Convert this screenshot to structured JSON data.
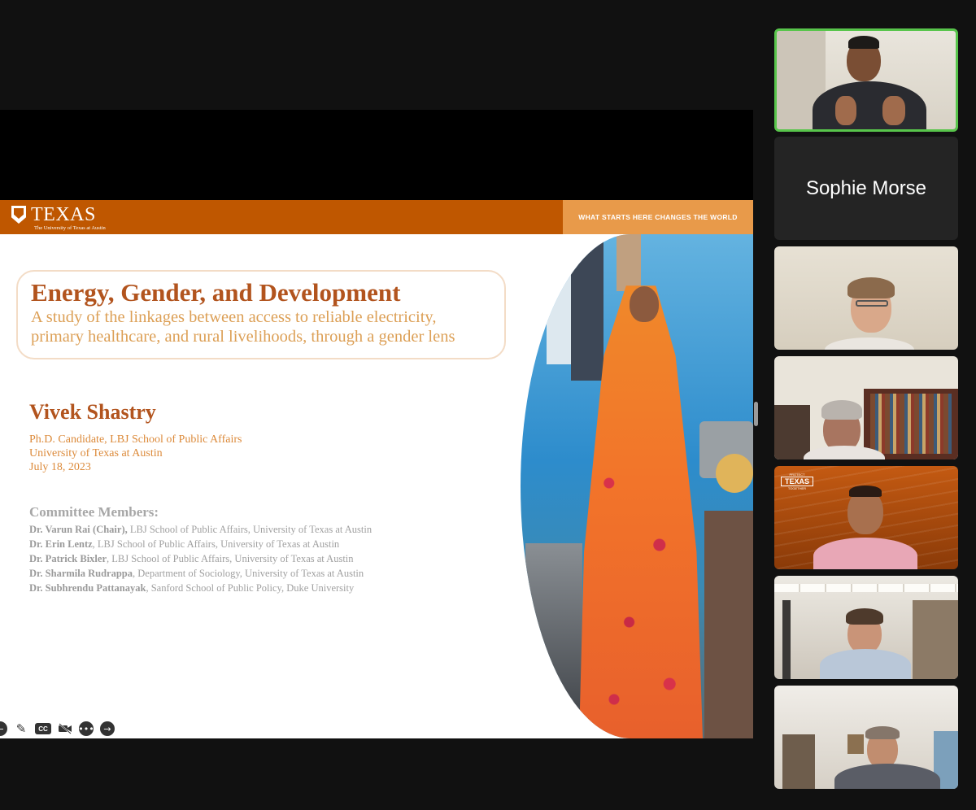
{
  "slide": {
    "logo_word": "TEXAS",
    "logo_sub": "The University of Texas at Austin",
    "tagline": "WHAT STARTS HERE CHANGES THE WORLD",
    "title": "Energy, Gender, and Development",
    "subtitle_line1": "A study of the linkages between access to reliable electricity,",
    "subtitle_line2": "primary healthcare, and rural livelihoods, through a gender lens",
    "presenter": "Vivek Shastry",
    "presenter_role": "Ph.D. Candidate, LBJ School of Public Affairs",
    "presenter_univ": "University of Texas at Austin",
    "date": "July 18, 2023",
    "committee_title": "Committee Members:",
    "committee": [
      {
        "name": "Dr. Varun Rai (Chair),",
        "affil": " LBJ School of Public Affairs, University of Texas at Austin"
      },
      {
        "name": "Dr. Erin Lentz",
        "affil": ", LBJ School of Public Affairs, University of Texas at Austin"
      },
      {
        "name": "Dr. Patrick Bixler",
        "affil": ", LBJ School of Public Affairs, University of Texas at Austin"
      },
      {
        "name": "Dr. Sharmila Rudrappa",
        "affil": ", Department of Sociology, University of Texas at Austin"
      },
      {
        "name": "Dr. Subhrendu Pattanayak",
        "affil": ", Sanford School of Public Policy, Duke University"
      }
    ]
  },
  "slide_toolbar": {
    "icons": [
      "arrow-left-icon",
      "pen-icon",
      "cc-icon",
      "video-off-icon",
      "more-icon",
      "arrow-right-icon"
    ],
    "cc_label": "CC"
  },
  "gallery": {
    "active_speaker_color": "#58c54b",
    "participants": [
      {
        "id": "speaker",
        "label": ""
      },
      {
        "id": "sophie",
        "label": "Sophie Morse"
      },
      {
        "id": "p3",
        "label": ""
      },
      {
        "id": "p4",
        "label": ""
      },
      {
        "id": "p5",
        "label": ""
      },
      {
        "id": "p6",
        "label": ""
      },
      {
        "id": "p7",
        "label": ""
      }
    ],
    "background_text": {
      "protect": "PROTECT",
      "texas": "TEXAS",
      "together": "TOGETHER"
    }
  },
  "colors": {
    "burnt_orange": "#bf5700",
    "tagline_bg": "#e89a4a",
    "title": "#b2541e",
    "subtitle": "#dc9f55"
  }
}
